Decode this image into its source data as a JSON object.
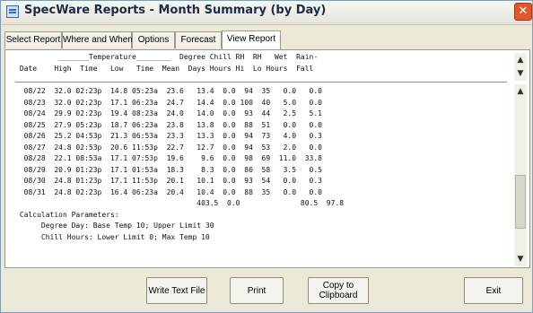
{
  "window": {
    "title": "SpecWare Reports - Month Summary (by Day)",
    "close_glyph": "✕"
  },
  "tabs": [
    {
      "label": "Select Report"
    },
    {
      "label": "Where and When"
    },
    {
      "label": "Options"
    },
    {
      "label": "Forecast"
    },
    {
      "label": "View Report"
    }
  ],
  "report": {
    "header_lines": [
      "          _______Temperature________  Degree Chill RH  RH   Wet  Rain-",
      " Date    High  Time   Low   Time  Mean  Days Hours Hi  Lo Hours  Fall"
    ],
    "lines": [
      "  08/22  32.0 02:23p  14.8 05:23a  23.6   13.4  0.0  94  35   0.0   0.0",
      "  08/23  32.0 02:23p  17.1 06:23a  24.7   14.4  0.0 100  40   5.0   0.0",
      "  08/24  29.9 02:23p  19.4 08:23a  24.0   14.0  0.0  93  44   2.5   5.1",
      "  08/25  27.9 05:23p  18.7 06:23a  23.8   13.8  0.0  88  51   0.0   0.0",
      "  08/26  25.2 04:53p  21.3 06:53a  23.3   13.3  0.0  94  73   4.0   0.3",
      "  08/27  24.8 02:53p  20.6 11:53p  22.7   12.7  0.0  94  53   2.0   0.0",
      "  08/28  22.1 08:53a  17.1 07:53p  19.6    9.6  0.0  98  69  11.0  33.8",
      "  08/29  20.9 01:23p  17.1 01:53a  18.3    8.3  0.0  86  58   3.5   0.5",
      "  08/30  24.8 01:23p  17.1 11:53p  20.1   10.1  0.0  93  54   0.0   0.3",
      "  08/31  24.8 02:23p  16.4 06:23a  20.4   10.4  0.0  88  35   0.0   0.0",
      "                                          403.5  0.0              80.5  97.8",
      "",
      " Calculation Parameters:",
      "      Degree Day: Base Temp 10; Upper Limit 30",
      "      Chill Hours: Lower Limit 0; Max Temp 10"
    ]
  },
  "buttons": {
    "write_text_file": "Write Text File",
    "print": "Print",
    "copy_to_clipboard": "Copy to\nClipboard",
    "exit": "Exit"
  }
}
